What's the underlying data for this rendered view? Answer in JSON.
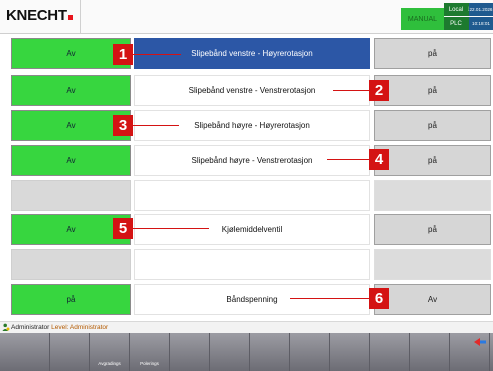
{
  "header": {
    "brand": "KNECHT",
    "mode": "MANUAL",
    "location": "Local",
    "plc": "PLC",
    "date": "22.01.2026",
    "time": "10:18:01",
    "colors": {
      "mode_bg": "#2fbf3c",
      "status_bg": "#1d7a2f",
      "datetime_bg": "#1f5a8f",
      "brand_dot": "#e8141c"
    }
  },
  "rows": [
    {
      "left": "Av",
      "label": "Slipebånd venstre - Høyrerotasjon",
      "right": "på",
      "callout": "1"
    },
    {
      "left": "Av",
      "label": "Slipebånd venstre - Venstrerotasjon",
      "right": "på",
      "callout": "2"
    },
    {
      "left": "Av",
      "label": "Slipebånd høyre - Høyrerotasjon",
      "right": "på",
      "callout": "3"
    },
    {
      "left": "Av",
      "label": "Slipebånd høyre - Venstrerotasjon",
      "right": "på",
      "callout": "4"
    },
    {
      "left": "",
      "label": "",
      "right": "",
      "callout": ""
    },
    {
      "left": "Av",
      "label": "Kjølemiddelventil",
      "right": "på",
      "callout": "5"
    },
    {
      "left": "",
      "label": "",
      "right": "",
      "callout": ""
    },
    {
      "left": "på",
      "label": "Båndspenning",
      "right": "Av",
      "callout": "6"
    }
  ],
  "status": {
    "user": "Administrator",
    "level": "Level: Administrator"
  },
  "toolbar": {
    "b3": "Avgradings",
    "b4": "Polerings"
  },
  "icons": {
    "user": "user-icon",
    "arrow": "arrow-left-icon"
  },
  "colors": {
    "button_green": "#37d63f",
    "active_row": "#2c57a6",
    "callout_red": "#d41313"
  }
}
